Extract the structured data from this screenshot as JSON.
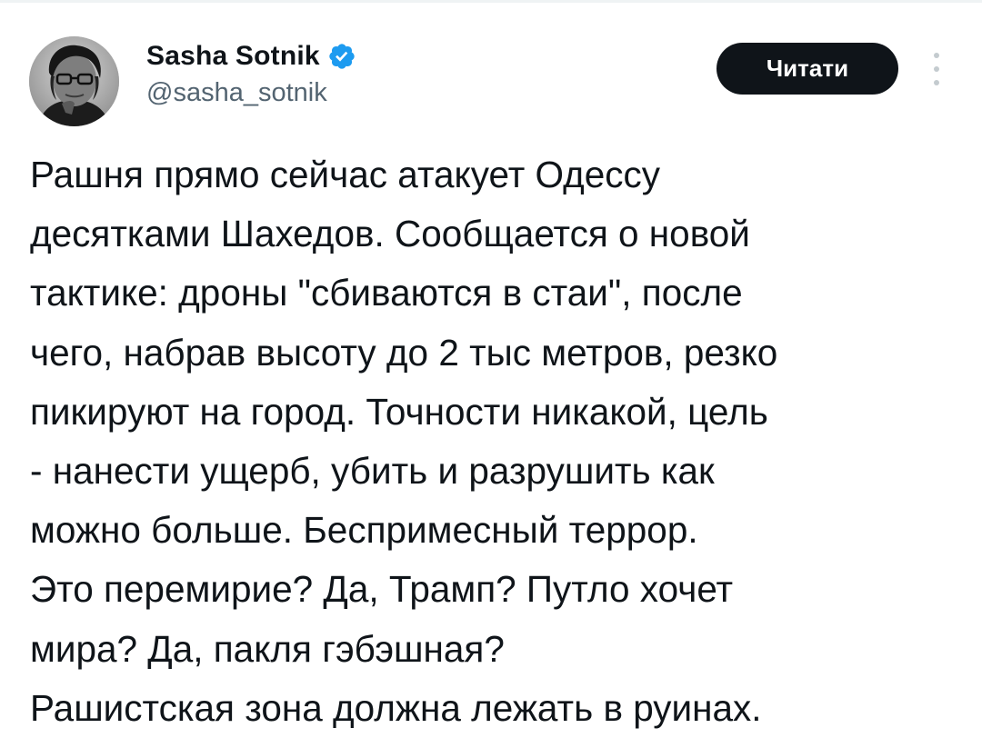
{
  "author": {
    "display_name": "Sasha Sotnik",
    "handle": "@sasha_sotnik",
    "verified": true,
    "avatar_icon": "profile-photo",
    "verified_icon": "verified-badge-icon",
    "verified_color": "#1d9bf0"
  },
  "actions": {
    "read_label": "Читати",
    "more_icon": "more-vertical-icon"
  },
  "tweet": {
    "lines": [
      "Рашня прямо сейчас атакует Одессу",
      "десятками Шахедов. Сообщается о новой",
      "тактике: дроны \"сбиваются в стаи\", после",
      "чего, набрав высоту до 2 тыс метров, резко",
      "пикируют на город. Точности никакой, цель",
      "- нанести ущерб, убить и разрушить как",
      "можно больше. Беспримесный террор.",
      "Это перемирие? Да, Трамп? Путло хочет",
      "мира? Да, пакля гэбэшная?",
      "Рашистская зона должна лежать в руинах."
    ]
  },
  "colors": {
    "text": "#0f1419",
    "secondary_text": "#536471",
    "button_bg": "#0f1419",
    "button_text": "#ffffff"
  }
}
